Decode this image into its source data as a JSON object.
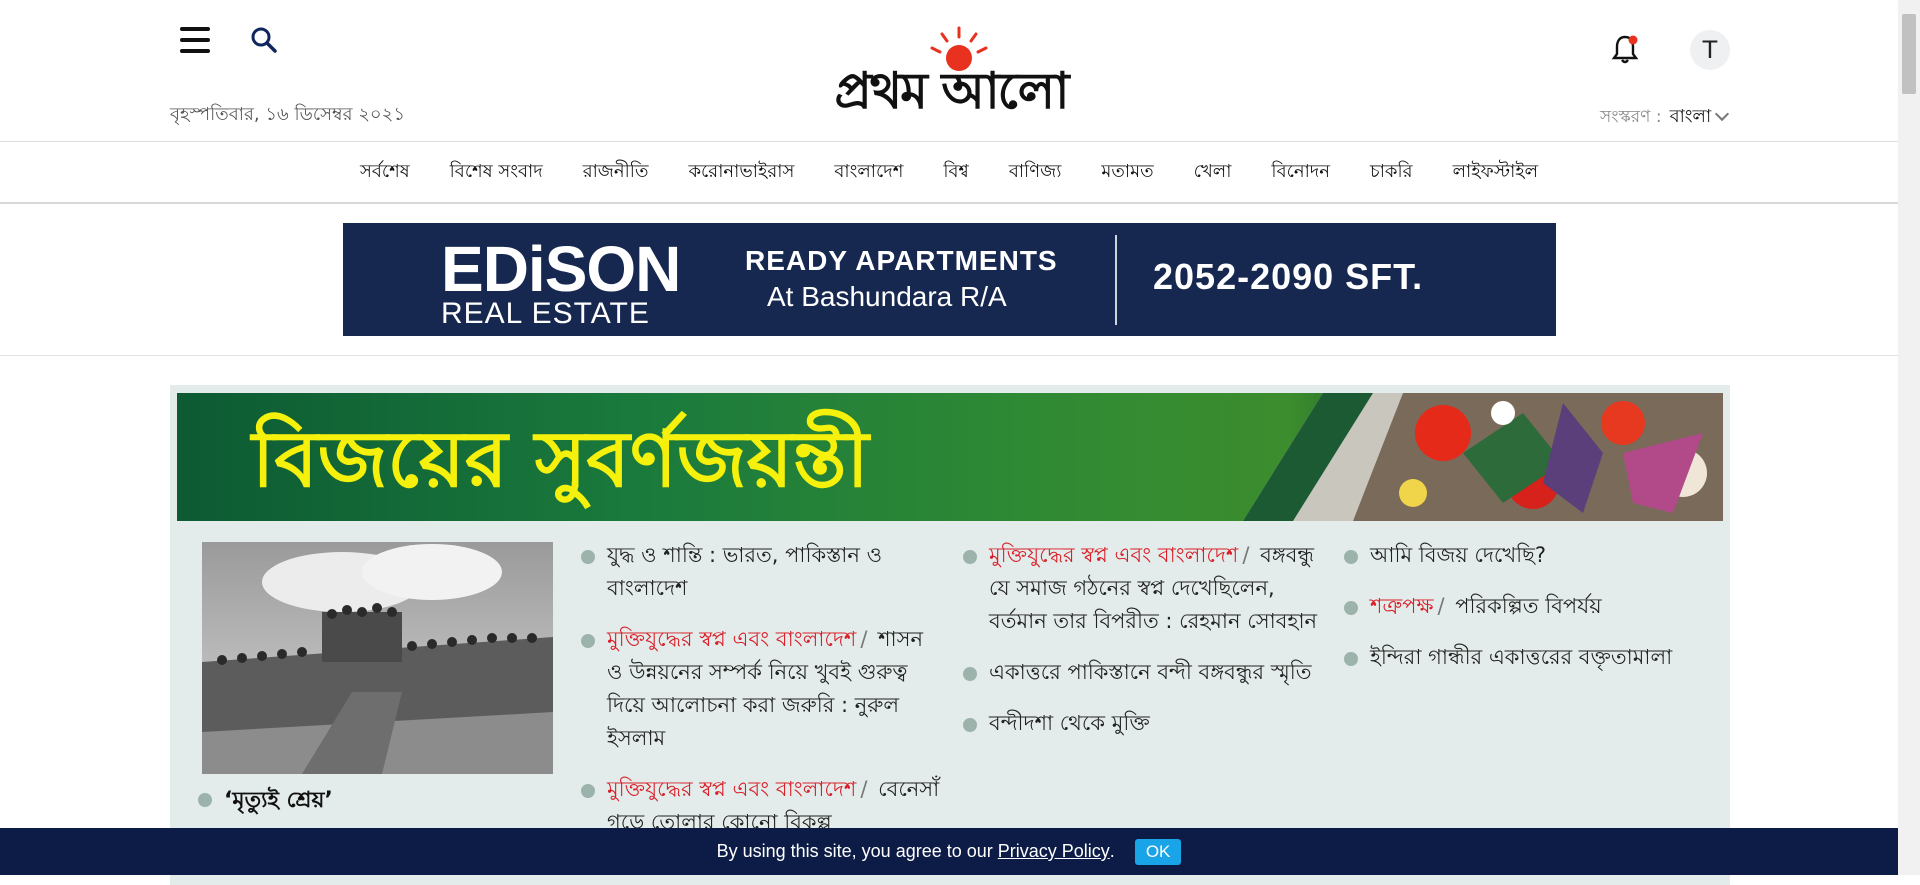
{
  "header": {
    "date": "বৃহস্পতিবার, ১৬ ডিসেম্বর ২০২১",
    "logo_text": "প্রথম আলো",
    "avatar_letter": "T",
    "edition_label": "সংস্করণ :",
    "edition_value": "বাংলা"
  },
  "nav": {
    "items": [
      "সর্বশেষ",
      "বিশেষ সংবাদ",
      "রাজনীতি",
      "করোনাভাইরাস",
      "বাংলাদেশ",
      "বিশ্ব",
      "বাণিজ্য",
      "মতামত",
      "খেলা",
      "বিনোদন",
      "চাকরি",
      "লাইফস্টাইল"
    ]
  },
  "ad": {
    "brand": "EDiSON",
    "brand_sub": "REAL ESTATE",
    "headline": "READY APARTMENTS",
    "subline": "At Bashundara R/A",
    "size": "2052-2090 SFT.",
    "colors": {
      "background": "#172850",
      "text": "#ffffff"
    }
  },
  "feature": {
    "banner_title": "বিজয়ের সুবর্ণজয়ন্তী",
    "photo_caption": "‘মৃত্যুই শ্রেয়’",
    "col1": [
      {
        "kicker": "",
        "title": "যুদ্ধ ও শান্তি : ভারত, পাকিস্তান ও বাংলাদেশ"
      },
      {
        "kicker": "মুক্তিযুদ্ধের স্বপ্ন এবং বাংলাদেশ",
        "title": "শাসন ও উন্নয়নের সম্পর্ক নিয়ে খুবই গুরুত্ব দিয়ে আলোচনা করা জরুরি : নুরুল ইসলাম"
      },
      {
        "kicker": "মুক্তিযুদ্ধের স্বপ্ন এবং বাংলাদেশ",
        "title": "বেনেসাঁ গড়ে তোলার কোনো বিকল্প"
      }
    ],
    "col2": [
      {
        "kicker": "মুক্তিযুদ্ধের স্বপ্ন এবং বাংলাদেশ",
        "title": "বঙ্গবন্ধু যে সমাজ গঠনের স্বপ্ন দেখেছিলেন, বর্তমান তার বিপরীত : রেহমান সোবহান"
      },
      {
        "kicker": "",
        "title": "একাত্তরে পাকিস্তানে বন্দী বঙ্গবন্ধুর স্মৃতি"
      },
      {
        "kicker": "",
        "title": "বন্দীদশা থেকে মুক্তি"
      }
    ],
    "col3": [
      {
        "kicker": "",
        "title": "আমি বিজয় দেখেছি?"
      },
      {
        "kicker": "শত্রুপক্ষ",
        "title": "পরিকল্পিত বিপর্যয়"
      },
      {
        "kicker": "",
        "title": "ইন্দিরা গান্ধীর একাত্তরের বক্তৃতামালা"
      }
    ],
    "colors": {
      "block_bg": "#e3ecea",
      "banner_text": "#f5f10c",
      "kicker": "#d9202a",
      "bullet": "#9cb3ac"
    }
  },
  "consent": {
    "text": "By using this site, you agree to our",
    "link": "Privacy Policy",
    "period": ".",
    "ok": "OK"
  },
  "icons": [
    "hamburger-icon",
    "search-icon",
    "sun-icon",
    "bell-icon",
    "chevron-down-icon"
  ]
}
